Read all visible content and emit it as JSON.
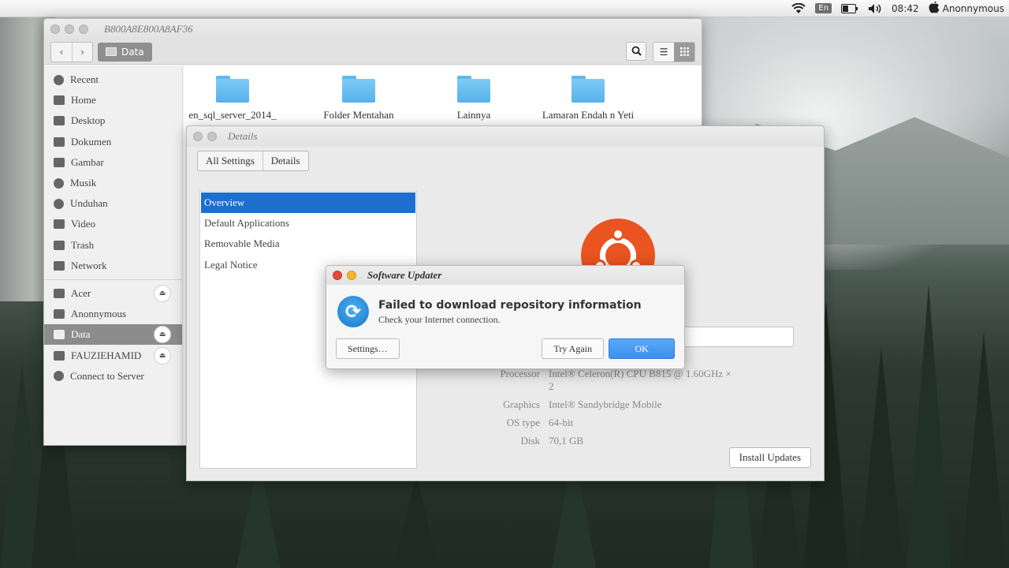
{
  "top_panel": {
    "keyboard_layout": "En",
    "time": "08:42",
    "user": "Anonnymous",
    "icons": [
      "wifi-icon",
      "battery-icon",
      "volume-icon",
      "apple-icon"
    ]
  },
  "file_manager": {
    "title": "B800A8E800A8AF36",
    "path_label": "Data",
    "sidebar": {
      "places": [
        {
          "label": "Recent",
          "icon": "clock-icon"
        },
        {
          "label": "Home",
          "icon": "home-icon"
        },
        {
          "label": "Desktop",
          "icon": "desktop-icon"
        },
        {
          "label": "Dokumen",
          "icon": "document-icon"
        },
        {
          "label": "Gambar",
          "icon": "picture-icon"
        },
        {
          "label": "Musik",
          "icon": "headphones-icon"
        },
        {
          "label": "Unduhan",
          "icon": "download-icon"
        },
        {
          "label": "Video",
          "icon": "film-icon"
        },
        {
          "label": "Trash",
          "icon": "trash-icon"
        },
        {
          "label": "Network",
          "icon": "network-icon"
        }
      ],
      "devices": [
        {
          "label": "Acer",
          "eject": true
        },
        {
          "label": "Anonnymous",
          "eject": false
        },
        {
          "label": "Data",
          "eject": true,
          "active": true
        },
        {
          "label": "FAUZIEHAMID",
          "eject": true
        },
        {
          "label": "Connect to Server",
          "eject": false
        }
      ]
    },
    "folders": [
      "en_sql_server_2014_",
      "Folder Mentahan",
      "Lainnya",
      "Lamaran Endah n Yeti"
    ]
  },
  "details": {
    "title": "Details",
    "tabs": [
      "All Settings",
      "Details"
    ],
    "list": [
      "Overview",
      "Default Applications",
      "Removable Media",
      "Legal Notice"
    ],
    "info": [
      {
        "label": "Processor",
        "value": "Intel® Celeron(R) CPU B815 @ 1.60GHz × 2"
      },
      {
        "label": "Graphics",
        "value": "Intel® Sandybridge Mobile"
      },
      {
        "label": "OS type",
        "value": "64-bit"
      },
      {
        "label": "Disk",
        "value": "70,1 GB"
      }
    ],
    "install_button": "Install Updates"
  },
  "updater": {
    "title": "Software Updater",
    "heading": "Failed to download repository information",
    "message": "Check your Internet connection.",
    "settings_button": "Settings…",
    "try_again_button": "Try Again",
    "ok_button": "OK"
  },
  "colors": {
    "selection_blue": "#1c6fcf",
    "ubuntu_orange": "#e95420",
    "folder_blue": "#5fb8ec",
    "ok_button_blue": "#3c8ff0"
  }
}
